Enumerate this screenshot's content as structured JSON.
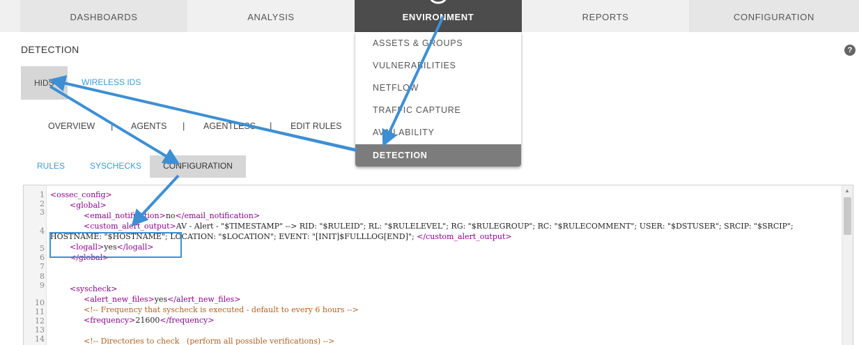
{
  "topnav": {
    "tabs": [
      {
        "label": "DASHBOARDS"
      },
      {
        "label": "ANALYSIS"
      },
      {
        "label": "ENVIRONMENT"
      },
      {
        "label": "REPORTS"
      },
      {
        "label": "CONFIGURATION"
      }
    ]
  },
  "dropdown": {
    "items": [
      {
        "label": "ASSETS & GROUPS"
      },
      {
        "label": "VULNERABILITIES"
      },
      {
        "label": "NETFLOW"
      },
      {
        "label": "TRAFFIC CAPTURE"
      },
      {
        "label": "AVAILABILITY"
      },
      {
        "label": "DETECTION"
      }
    ]
  },
  "page": {
    "title": "DETECTION",
    "help": "?"
  },
  "subtabs": {
    "hids": "HIDS",
    "wireless": "WIRELESS IDS"
  },
  "hidsnav": {
    "overview": "OVERVIEW",
    "agents": "AGENTS",
    "agentless": "AGENTLESS",
    "edit_rules": "EDIT RULES",
    "sep": "|"
  },
  "configtabs": {
    "rules": "RULES",
    "syschecks": "SYSCHECKS",
    "configuration": "CONFIGURATION"
  },
  "editor": {
    "line_numbers": [
      "1",
      "2",
      "3",
      "4",
      "5",
      "6",
      "7",
      "8",
      "9",
      "10",
      "11",
      "12",
      "13",
      "14"
    ],
    "l1_open": "<ossec_config>",
    "l2_open": "<global>",
    "l3_open": "<email_notification>",
    "l3_val": "no",
    "l3_close": "</email_notification>",
    "l4_open": "<custom_alert_output>",
    "l4_val_a": "AV - Alert - \"$TIMESTAMP\" --> RID: \"$RULEID\"; RL: \"$RULELEVEL\"; RG: \"$RULEGROUP\"; RC: \"$RULECOMMENT\"; USER: \"$DSTUSER\"; SRCIP: \"$SRCIP\";",
    "l4_val_b": "HOSTNAME: \"$HOSTNAME\"; LOCATION: \"$LOCATION\"; EVENT: \"[INIT]$FULLLOG[END]\"; ",
    "l4_close": "</custom_alert_output>",
    "l5_open": "<logall>",
    "l5_val": "yes",
    "l5_close": "</logall>",
    "l6_close": "</global>",
    "l9_open": "<syscheck>",
    "l10_open": "<alert_new_files>",
    "l10_val": "yes",
    "l10_close": "</alert_new_files>",
    "l11_comment": "<!-- Frequency that syscheck is executed - default to every 6 hours -->",
    "l12_open": "<frequency>",
    "l12_val": "21600",
    "l12_close": "</frequency>",
    "l14_comment": "<!-- Directories to check   (perform all possible verifications) -->"
  },
  "colors": {
    "accent_blue": "#3b9bd6",
    "annotation_blue": "#3d8fd4",
    "active_nav": "#4c4c4c",
    "xml_tag": "#8a008a"
  }
}
